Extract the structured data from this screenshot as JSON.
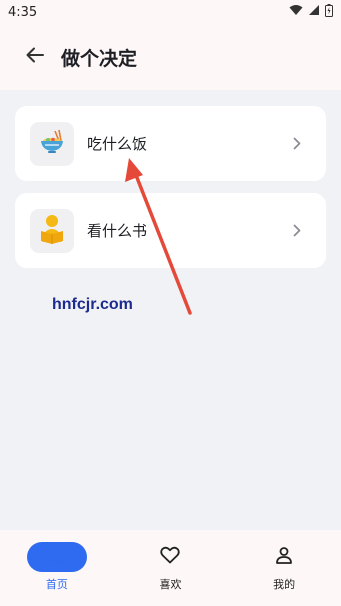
{
  "status_bar": {
    "time": "4:35",
    "icons": [
      "wifi-icon",
      "cellular-signal-icon",
      "battery-icon"
    ]
  },
  "header": {
    "title": "做个决定",
    "back_icon": "arrow-left-icon"
  },
  "cards": [
    {
      "label": "吃什么饭",
      "icon": "food-bowl-icon"
    },
    {
      "label": "看什么书",
      "icon": "reading-person-icon"
    }
  ],
  "watermark": "hnfcjr.com",
  "bottom_nav": {
    "items": [
      {
        "label": "首页",
        "icon": "home-icon",
        "active": true
      },
      {
        "label": "喜欢",
        "icon": "heart-icon",
        "active": false
      },
      {
        "label": "我的",
        "icon": "person-icon",
        "active": false
      }
    ]
  },
  "colors": {
    "accent": "#2f6bf0",
    "background": "#f1f2f5",
    "bar_background": "#fdf7f7",
    "annotation_arrow": "#e4493a",
    "watermark": "#1c2b8f"
  }
}
